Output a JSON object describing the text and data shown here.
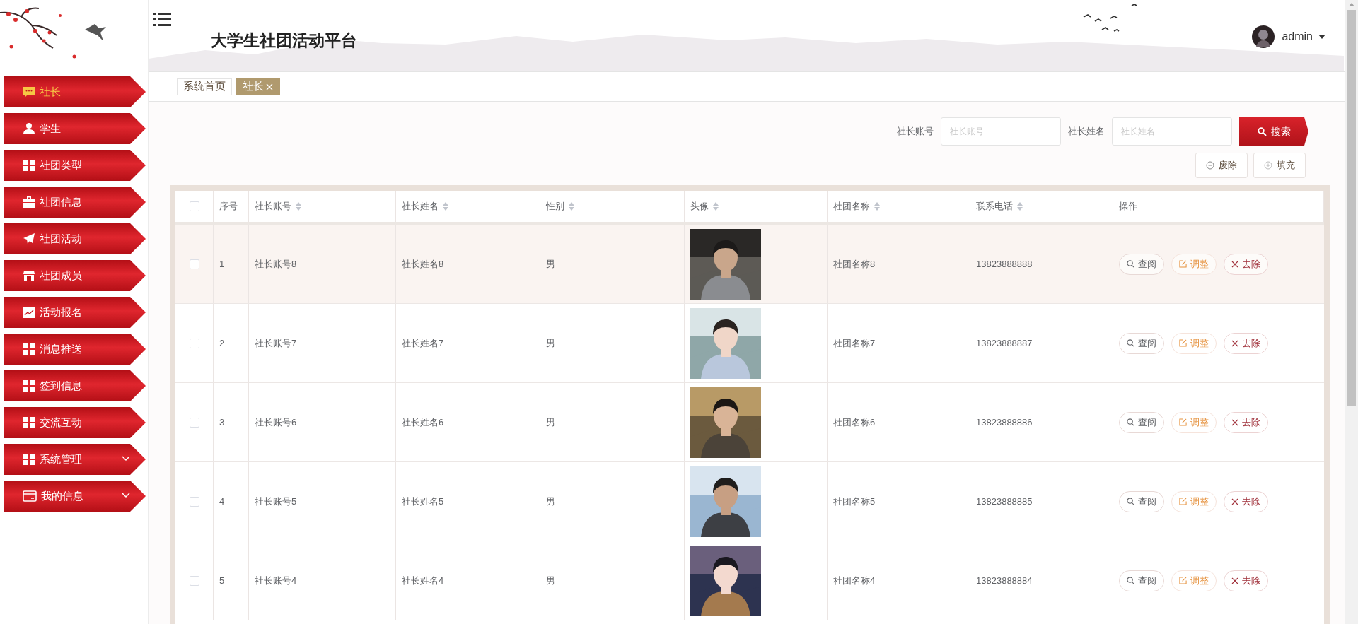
{
  "header": {
    "title": "大学生社团活动平台",
    "user": {
      "name": "admin"
    }
  },
  "sidebar": {
    "items": [
      {
        "label": "社长",
        "kind": "chat",
        "selected": true,
        "has_submenu": false
      },
      {
        "label": "学生",
        "kind": "user",
        "selected": false,
        "has_submenu": false
      },
      {
        "label": "社团类型",
        "kind": "grid",
        "selected": false,
        "has_submenu": false
      },
      {
        "label": "社团信息",
        "kind": "briefcase",
        "selected": false,
        "has_submenu": false
      },
      {
        "label": "社团活动",
        "kind": "send",
        "selected": false,
        "has_submenu": false
      },
      {
        "label": "社团成员",
        "kind": "store",
        "selected": false,
        "has_submenu": false
      },
      {
        "label": "活动报名",
        "kind": "chart",
        "selected": false,
        "has_submenu": false
      },
      {
        "label": "消息推送",
        "kind": "grid",
        "selected": false,
        "has_submenu": false
      },
      {
        "label": "签到信息",
        "kind": "grid",
        "selected": false,
        "has_submenu": false
      },
      {
        "label": "交流互动",
        "kind": "grid",
        "selected": false,
        "has_submenu": false
      },
      {
        "label": "系统管理",
        "kind": "grid",
        "selected": false,
        "has_submenu": true
      },
      {
        "label": "我的信息",
        "kind": "card",
        "selected": false,
        "has_submenu": true
      }
    ]
  },
  "tabs": [
    {
      "label": "系统首页",
      "selected": false,
      "closable": false
    },
    {
      "label": "社长",
      "selected": true,
      "closable": true
    }
  ],
  "search": {
    "fields": [
      {
        "label": "社长账号",
        "placeholder": "社长账号"
      },
      {
        "label": "社长姓名",
        "placeholder": "社长姓名"
      }
    ],
    "button": "搜索"
  },
  "toolbar": [
    {
      "label": "废除",
      "kind": "minus"
    },
    {
      "label": "填充",
      "kind": "plus"
    }
  ],
  "table": {
    "select_all": {
      "checked": false
    },
    "columns": [
      {
        "label": "序号",
        "sortable": false
      },
      {
        "label": "社长账号",
        "sortable": true
      },
      {
        "label": "社长姓名",
        "sortable": true
      },
      {
        "label": "性别",
        "sortable": true
      },
      {
        "label": "头像",
        "sortable": true
      },
      {
        "label": "社团名称",
        "sortable": true
      },
      {
        "label": "联系电话",
        "sortable": true
      },
      {
        "label": "操作",
        "sortable": false
      }
    ],
    "rows": [
      {
        "checked": false,
        "highlighted": true,
        "index": "1",
        "account": "社长账号8",
        "name": "社长姓名8",
        "gender": "男",
        "club": "社团名称8",
        "phone": "13823888888",
        "actions": [
          {
            "label": "查阅",
            "kind": "view"
          },
          {
            "label": "调整",
            "kind": "edit"
          },
          {
            "label": "去除",
            "kind": "delete"
          }
        ]
      },
      {
        "checked": false,
        "highlighted": false,
        "index": "2",
        "account": "社长账号7",
        "name": "社长姓名7",
        "gender": "男",
        "club": "社团名称7",
        "phone": "13823888887",
        "actions": [
          {
            "label": "查阅",
            "kind": "view"
          },
          {
            "label": "调整",
            "kind": "edit"
          },
          {
            "label": "去除",
            "kind": "delete"
          }
        ]
      },
      {
        "checked": false,
        "highlighted": false,
        "index": "3",
        "account": "社长账号6",
        "name": "社长姓名6",
        "gender": "男",
        "club": "社团名称6",
        "phone": "13823888886",
        "actions": [
          {
            "label": "查阅",
            "kind": "view"
          },
          {
            "label": "调整",
            "kind": "edit"
          },
          {
            "label": "去除",
            "kind": "delete"
          }
        ]
      },
      {
        "checked": false,
        "highlighted": false,
        "index": "4",
        "account": "社长账号5",
        "name": "社长姓名5",
        "gender": "男",
        "club": "社团名称5",
        "phone": "13823888885",
        "actions": [
          {
            "label": "查阅",
            "kind": "view"
          },
          {
            "label": "调整",
            "kind": "edit"
          },
          {
            "label": "去除",
            "kind": "delete"
          }
        ]
      },
      {
        "checked": false,
        "highlighted": false,
        "index": "5",
        "account": "社长账号4",
        "name": "社长姓名4",
        "gender": "男",
        "club": "社团名称4",
        "phone": "13823888884",
        "actions": [
          {
            "label": "查阅",
            "kind": "view"
          },
          {
            "label": "调整",
            "kind": "edit"
          },
          {
            "label": "去除",
            "kind": "delete"
          }
        ]
      }
    ]
  }
}
